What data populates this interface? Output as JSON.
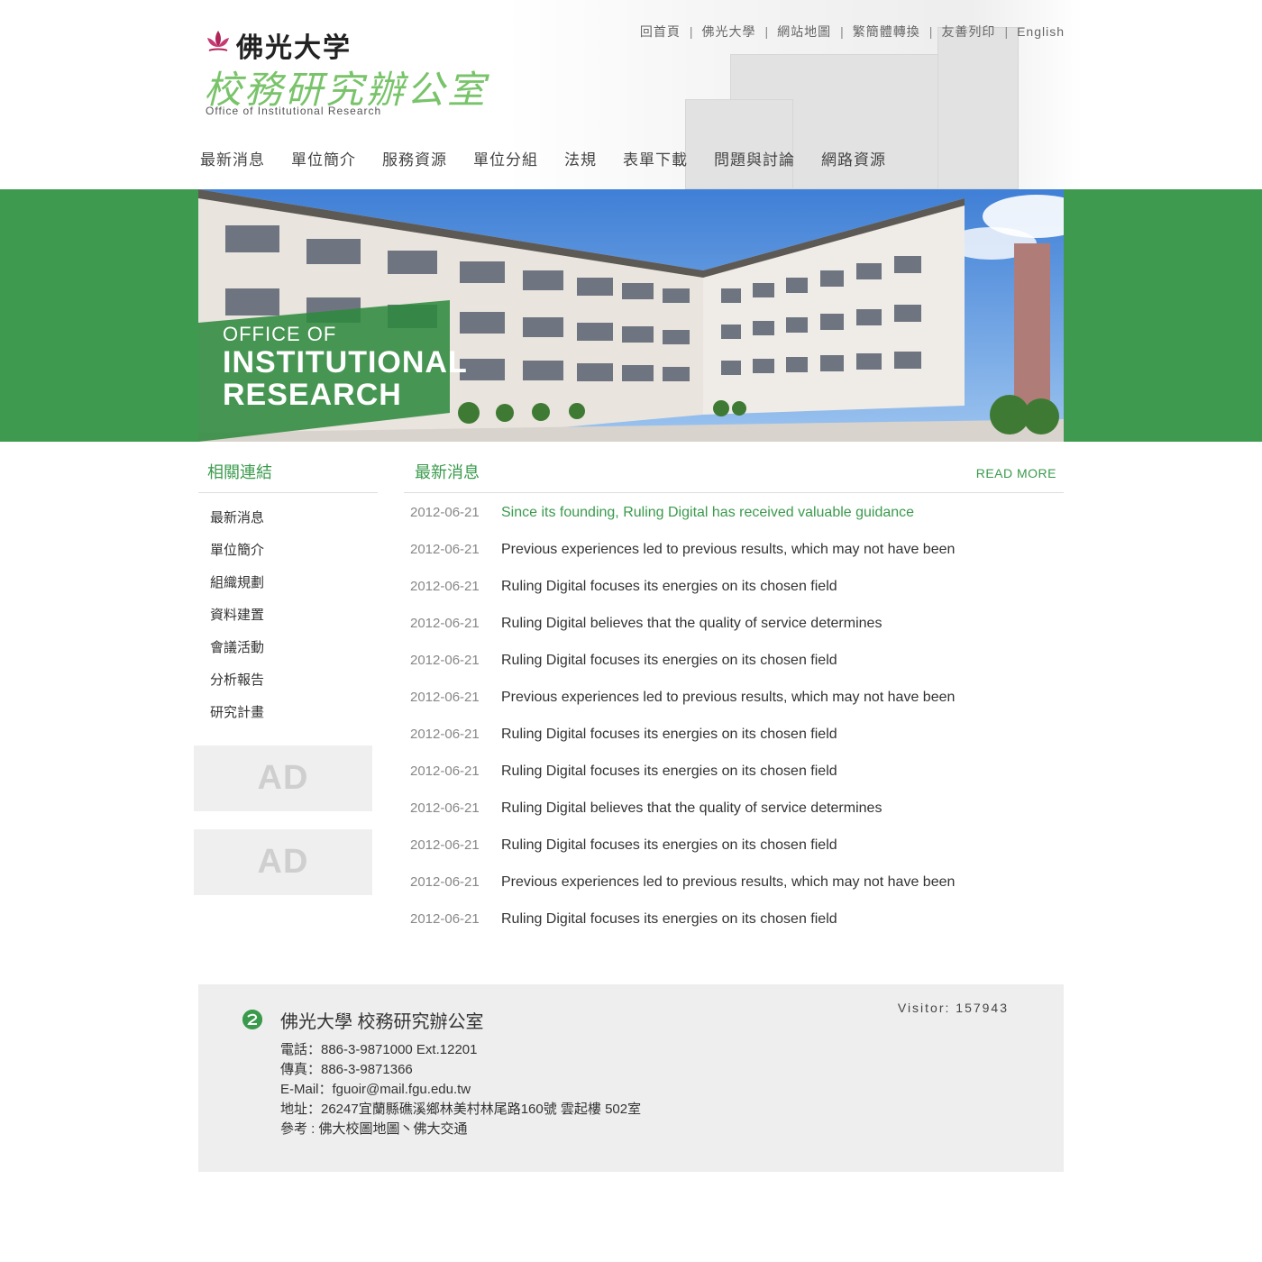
{
  "header": {
    "university_name": "佛光大学",
    "office_name_cn": "校務研究辦公室",
    "office_name_en": "Office of Institutional Research",
    "top_links": [
      "回首頁",
      "佛光大學",
      "網站地圖",
      "繁簡體轉換",
      "友善列印",
      "English"
    ],
    "top_link_separator": "|"
  },
  "main_nav": [
    "最新消息",
    "單位簡介",
    "服務資源",
    "單位分組",
    "法規",
    "表單下載",
    "問題與討論",
    "網路資源"
  ],
  "banner": {
    "line1": "OFFICE OF",
    "line2": "INSTITUTIONAL",
    "line3": "RESEARCH"
  },
  "sidebar": {
    "title": "相關連結",
    "items": [
      "最新消息",
      "單位簡介",
      "組織規劃",
      "資料建置",
      "會議活動",
      "分析報告",
      "研究計畫"
    ],
    "ads": [
      "AD",
      "AD"
    ]
  },
  "news": {
    "title": "最新消息",
    "read_more": "READ MORE",
    "items": [
      {
        "date": "2012-06-21",
        "title": "Since its founding, Ruling Digital has received valuable guidance"
      },
      {
        "date": "2012-06-21",
        "title": "Previous experiences led to previous results,  which may not  have been"
      },
      {
        "date": "2012-06-21",
        "title": "Ruling Digital focuses its energies on its chosen field"
      },
      {
        "date": "2012-06-21",
        "title": "Ruling Digital believes that the quality of service determines"
      },
      {
        "date": "2012-06-21",
        "title": "Ruling Digital focuses its energies on its chosen field"
      },
      {
        "date": "2012-06-21",
        "title": "Previous experiences led to previous results,  which may not  have been"
      },
      {
        "date": "2012-06-21",
        "title": "Ruling Digital focuses its energies on its chosen field"
      },
      {
        "date": "2012-06-21",
        "title": "Ruling Digital focuses its energies on its chosen field"
      },
      {
        "date": "2012-06-21",
        "title": "Ruling Digital believes that the quality of service determines"
      },
      {
        "date": "2012-06-21",
        "title": "Ruling Digital focuses its energies on its chosen field"
      },
      {
        "date": "2012-06-21",
        "title": "Previous experiences led to previous results,  which may not  have been"
      },
      {
        "date": "2012-06-21",
        "title": "Ruling Digital focuses its energies on its chosen field"
      }
    ]
  },
  "footer": {
    "org_name": "佛光大學 校務研究辦公室",
    "visitor": "Visitor: 157943",
    "phone": "電話：886-3-9871000 Ext.12201",
    "fax": "傳真：886-3-9871366",
    "email": "E-Mail：fguoir@mail.fgu.edu.tw",
    "address": "地址：26247宜蘭縣礁溪鄉林美村林尾路160號 雲起樓 502室",
    "reference": "參考 : 佛大校圖地圖丶佛大交通"
  },
  "colors": {
    "brand_green": "#3d9a4f",
    "title_green": "#79c36a",
    "text": "#333333"
  }
}
